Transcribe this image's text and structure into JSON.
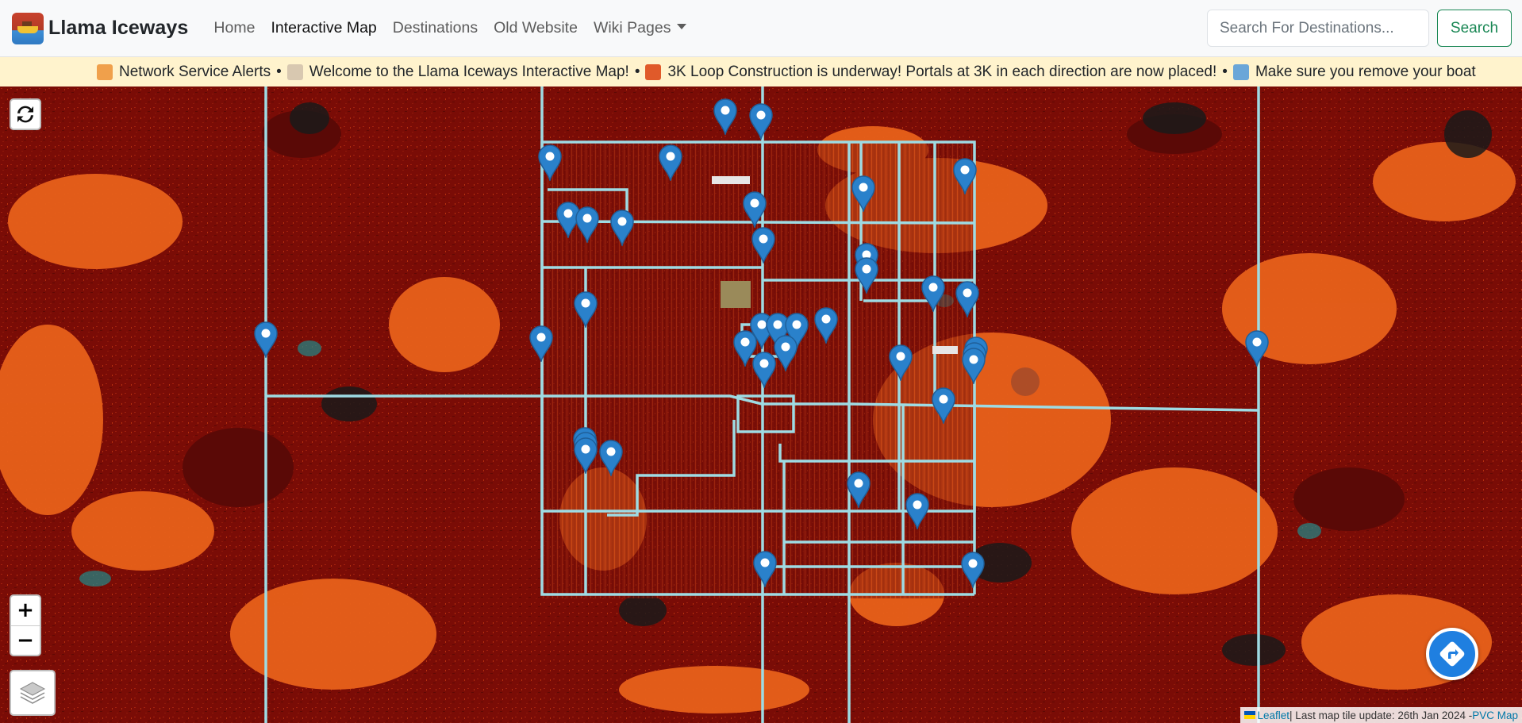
{
  "navbar": {
    "brand_name": "Llama Iceways",
    "links": [
      {
        "label": "Home"
      },
      {
        "label": "Interactive Map"
      },
      {
        "label": "Destinations"
      },
      {
        "label": "Old Website"
      },
      {
        "label": "Wiki Pages"
      }
    ],
    "search_placeholder": "Search For Destinations...",
    "search_button": "Search"
  },
  "ticker": {
    "items": [
      {
        "icon": "megaphone-icon",
        "color": "#f0a04b",
        "text": "Network Service Alerts"
      },
      {
        "icon": "llama-icon",
        "color": "#d8c8b0",
        "text": "Welcome to the Llama Iceways Interactive Map!"
      },
      {
        "icon": "construction-icon",
        "color": "#e05a2a",
        "text": "3K Loop Construction is underway! Portals at 3K in each direction are now placed!"
      },
      {
        "icon": "ship-icon",
        "color": "#6aa6d8",
        "text": "Make sure you remove your boat"
      }
    ],
    "separator": "•"
  },
  "map": {
    "controls": {
      "zoom_in": "+",
      "zoom_out": "−"
    },
    "attribution": {
      "leaflet": "Leaflet",
      "text": "| Last map tile update: 26th Jan 2024 - ",
      "map_link": "PVC Map"
    },
    "colors": {
      "ice_road": "#9edbe3",
      "marker": "#2a81cb",
      "terrain_dark": "#7a0c06",
      "terrain_orange": "#e8611a"
    }
  }
}
